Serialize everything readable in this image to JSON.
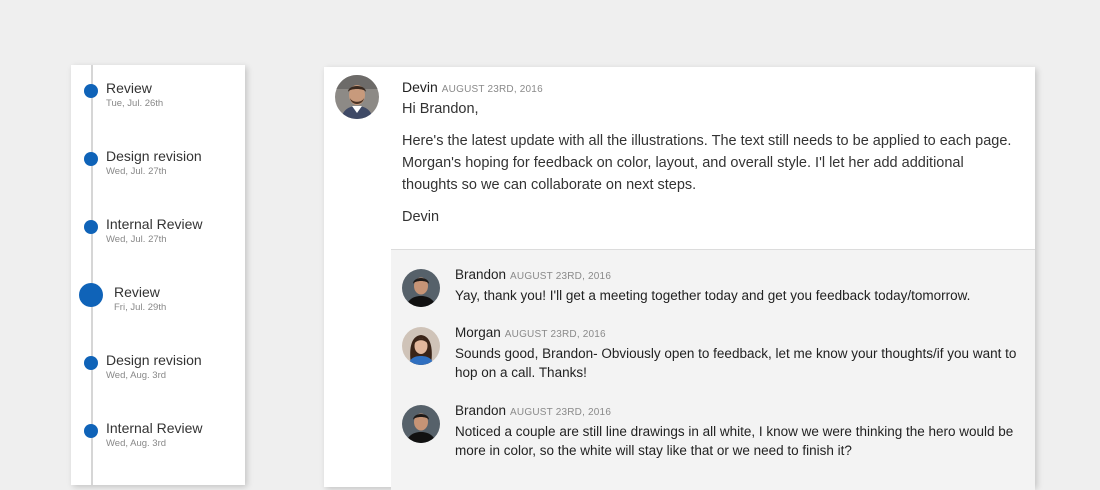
{
  "timeline": {
    "items": [
      {
        "title": "Review",
        "date": "Tue, Jul. 26th"
      },
      {
        "title": "Design revision",
        "date": "Wed, Jul. 27th"
      },
      {
        "title": "Internal Review",
        "date": "Wed, Jul. 27th"
      },
      {
        "title": "Review",
        "date": "Fri, Jul. 29th",
        "active": true
      },
      {
        "title": "Design revision",
        "date": "Wed, Aug. 3rd"
      },
      {
        "title": "Internal Review",
        "date": "Wed, Aug. 3rd"
      }
    ]
  },
  "message": {
    "author": "Devin",
    "date": "AUGUST 23RD, 2016",
    "greeting": "Hi Brandon,",
    "body": "Here's the latest update with all the illustrations. The text still needs to be applied to each page. Morgan's hoping for feedback on color, layout, and overall style. I'l let her add additional thoughts so we can collaborate on next steps.",
    "signature": "Devin"
  },
  "replies": [
    {
      "author": "Brandon",
      "date": "AUGUST 23RD, 2016",
      "text": "Yay, thank you! I'll get a meeting together today and get you feedback today/tomorrow."
    },
    {
      "author": "Morgan",
      "date": "AUGUST 23RD, 2016",
      "text": "Sounds good, Brandon- Obviously open to feedback, let me know your thoughts/if you want to hop on a call. Thanks!"
    },
    {
      "author": "Brandon",
      "date": "AUGUST 23RD, 2016",
      "text": "Noticed a couple are still line drawings in all white, I know we were thinking the hero would be more in color, so the white will stay like that or we need to finish it?"
    }
  ],
  "colors": {
    "accent": "#0f63b8",
    "background": "#efefef",
    "card": "#ffffff",
    "replies_bg": "#f3f3f3"
  },
  "icons": {
    "timeline_marker": "timeline-dot-icon"
  }
}
